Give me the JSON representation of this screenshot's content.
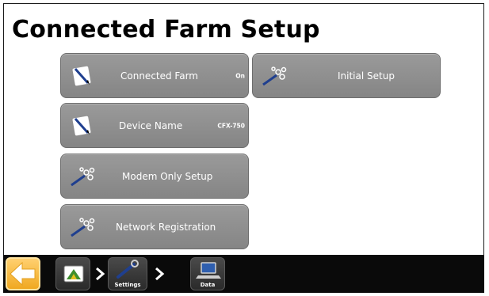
{
  "page": {
    "title": "Connected Farm Setup"
  },
  "tiles": [
    {
      "label": "Connected Farm",
      "value": "On",
      "icon": "notepad-pencil-icon"
    },
    {
      "label": "Initial Setup",
      "value": "",
      "icon": "wand-sparkle-icon"
    },
    {
      "label": "Device Name",
      "value": "CFX-750",
      "icon": "notepad-pencil-icon"
    },
    {
      "label": "Modem Only Setup",
      "value": "",
      "icon": "wand-sparkle-icon"
    },
    {
      "label": "Network Registration",
      "value": "",
      "icon": "wand-sparkle-icon"
    }
  ],
  "nav": {
    "home_icon": "back-arrow-icon",
    "crumbs": [
      {
        "label": "",
        "icon": "field-screen-icon"
      },
      {
        "label": "Settings",
        "icon": "wrench-icon"
      },
      {
        "label": "Data",
        "icon": "laptop-icon"
      }
    ]
  },
  "colors": {
    "tile": "#8f8f8f",
    "bar": "#0a0a0a",
    "home": "#f0a820"
  }
}
